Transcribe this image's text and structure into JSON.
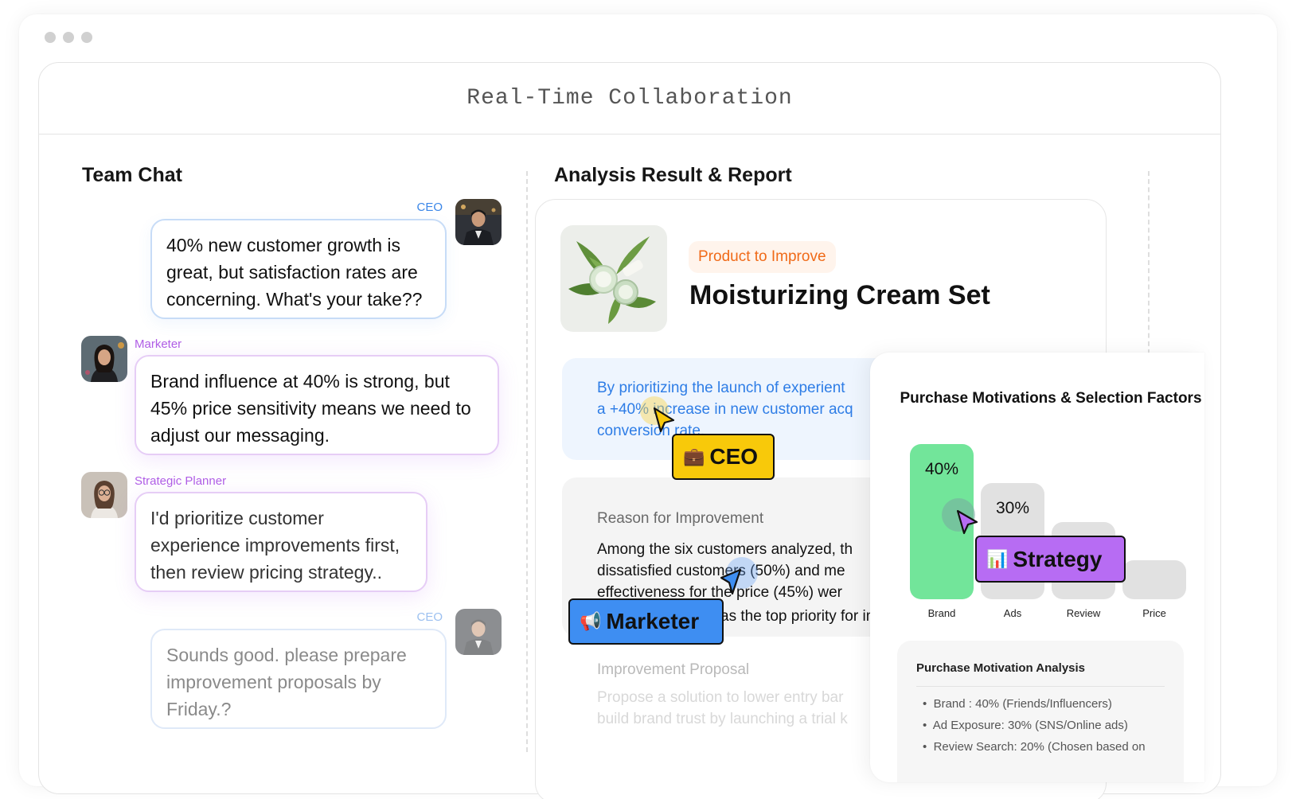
{
  "window": {
    "title": "Real-Time Collaboration"
  },
  "team_chat": {
    "title": "Team Chat",
    "messages": [
      {
        "sender": "CEO",
        "lines": [
          "40% new customer growth is",
          "great, but satisfaction rates are",
          "concerning. What's your take??"
        ]
      },
      {
        "sender": "Marketer",
        "lines": [
          "Brand influence at 40% is strong, but",
          "45% price sensitivity means we need to",
          "adjust our messaging."
        ]
      },
      {
        "sender": "Strategic Planner",
        "lines": [
          "I'd prioritize customer",
          "experience improvements first,",
          "then review pricing strategy.."
        ]
      },
      {
        "sender": "CEO",
        "lines": [
          "Sounds good. please prepare",
          "improvement proposals by",
          "Friday.?"
        ]
      }
    ]
  },
  "report": {
    "title": "Analysis Result & Report",
    "tag": "Product to Improve",
    "product_name": "Moisturizing Cream Set",
    "insight_lines": [
      "By prioritizing the launch of experient",
      "a +40% increase in new customer acq",
      "conversion rate."
    ],
    "reason_label": "Reason for Improvement",
    "reason_lines": [
      "Among the six customers analyzed, th",
      "dissatisfied customers (50%) and me",
      "effectiveness for the price (45%) wer",
      "as the top priority for impro"
    ],
    "proposal_label": "Improvement Proposal",
    "proposal_lines": [
      "Propose a solution to lower entry bar",
      "build brand trust by launching a trial k"
    ]
  },
  "chart_data": {
    "type": "bar",
    "title": "Purchase Motivations & Selection Factors",
    "categories": [
      "Brand",
      "Ads",
      "Review",
      "Price"
    ],
    "values": [
      40,
      30,
      20,
      10
    ],
    "value_labels": [
      "40%",
      "30%",
      "",
      ""
    ],
    "colors": [
      "#72e59a",
      "#e1e1e1",
      "#e1e1e1",
      "#e1e1e1"
    ]
  },
  "analysis": {
    "title": "Purchase Motivation Analysis",
    "items": [
      "Brand : 40% (Friends/Influencers)",
      "Ad Exposure: 30% (SNS/Online ads)",
      "Review Search: 20% (Chosen based on"
    ]
  },
  "cursors": {
    "ceo": {
      "label": "CEO",
      "icon": "briefcase-icon",
      "color": "#f8c90a"
    },
    "marketer": {
      "label": "Marketer",
      "icon": "megaphone-icon",
      "color": "#3e8ef2"
    },
    "strategy": {
      "label": "Strategy",
      "icon": "bar-chart-icon",
      "color": "#b76cf3"
    }
  },
  "icons": {
    "briefcase": "💼",
    "megaphone": "📢",
    "chart": "📊"
  }
}
